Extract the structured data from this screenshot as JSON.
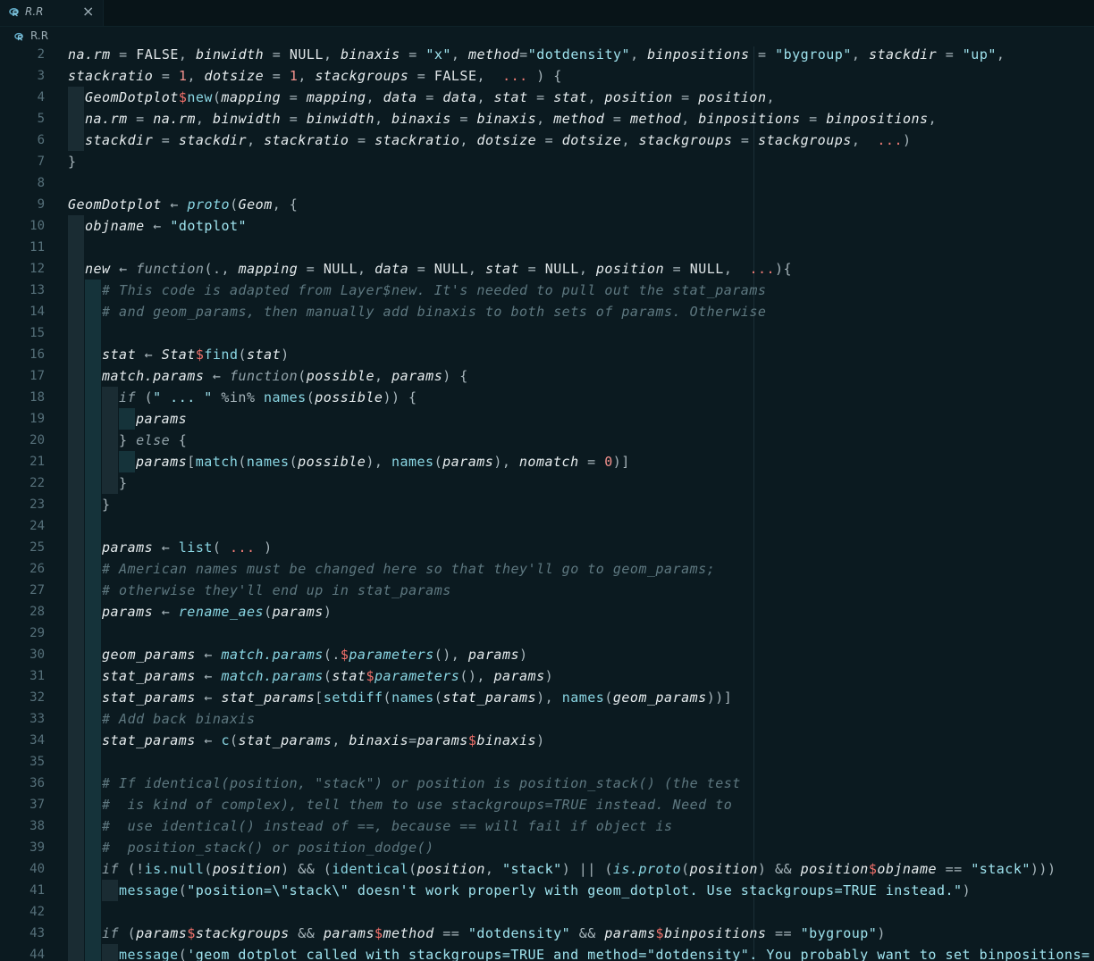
{
  "tab": {
    "label": "R.R",
    "close": "×",
    "icon": "r-file-icon"
  },
  "breadcrumb": {
    "label": "R.R",
    "icon": "r-file-icon"
  },
  "colors": {
    "background": "#0b1a20",
    "string": "#9fe3ee",
    "number": "#f2918d",
    "function": "#8ad6e3",
    "comment": "#5e7880",
    "dollar": "#f2716b"
  },
  "lines": [
    {
      "n": "2",
      "g": 0,
      "t": [
        [
          "arg",
          "na.rm"
        ],
        [
          "op",
          " = "
        ],
        [
          "val",
          "FALSE"
        ],
        [
          "op",
          ", "
        ],
        [
          "arg",
          "binwidth"
        ],
        [
          "op",
          " = "
        ],
        [
          "val",
          "NULL"
        ],
        [
          "op",
          ", "
        ],
        [
          "arg",
          "binaxis"
        ],
        [
          "op",
          " = "
        ],
        [
          "str",
          "\"x\""
        ],
        [
          "op",
          ", "
        ],
        [
          "arg",
          "method"
        ],
        [
          "op",
          "="
        ],
        [
          "str",
          "\"dotdensity\""
        ],
        [
          "op",
          ", "
        ],
        [
          "arg",
          "binpositions"
        ],
        [
          "op",
          " = "
        ],
        [
          "str",
          "\"bygroup\""
        ],
        [
          "op",
          ", "
        ],
        [
          "arg",
          "stackdir"
        ],
        [
          "op",
          " = "
        ],
        [
          "str",
          "\"up\""
        ],
        [
          "op",
          ","
        ]
      ]
    },
    {
      "n": "3",
      "g": 0,
      "t": [
        [
          "arg",
          "stackratio"
        ],
        [
          "op",
          " = "
        ],
        [
          "num",
          "1"
        ],
        [
          "op",
          ", "
        ],
        [
          "arg",
          "dotsize"
        ],
        [
          "op",
          " = "
        ],
        [
          "num",
          "1"
        ],
        [
          "op",
          ", "
        ],
        [
          "arg",
          "stackgroups"
        ],
        [
          "op",
          " = "
        ],
        [
          "val",
          "FALSE"
        ],
        [
          "op",
          ",  "
        ],
        [
          "dots",
          "..."
        ],
        [
          "op",
          " ) {"
        ]
      ]
    },
    {
      "n": "4",
      "g": 1,
      "t": [
        [
          "id",
          "GeomDotplot"
        ],
        [
          "dol",
          "$"
        ],
        [
          "fn",
          "new"
        ],
        [
          "op",
          "("
        ],
        [
          "arg",
          "mapping"
        ],
        [
          "op",
          " = "
        ],
        [
          "id",
          "mapping"
        ],
        [
          "op",
          ", "
        ],
        [
          "arg",
          "data"
        ],
        [
          "op",
          " = "
        ],
        [
          "id",
          "data"
        ],
        [
          "op",
          ", "
        ],
        [
          "arg",
          "stat"
        ],
        [
          "op",
          " = "
        ],
        [
          "id",
          "stat"
        ],
        [
          "op",
          ", "
        ],
        [
          "arg",
          "position"
        ],
        [
          "op",
          " = "
        ],
        [
          "id",
          "position"
        ],
        [
          "op",
          ","
        ]
      ]
    },
    {
      "n": "5",
      "g": 1,
      "t": [
        [
          "arg",
          "na.rm"
        ],
        [
          "op",
          " = "
        ],
        [
          "id",
          "na.rm"
        ],
        [
          "op",
          ", "
        ],
        [
          "arg",
          "binwidth"
        ],
        [
          "op",
          " = "
        ],
        [
          "id",
          "binwidth"
        ],
        [
          "op",
          ", "
        ],
        [
          "arg",
          "binaxis"
        ],
        [
          "op",
          " = "
        ],
        [
          "id",
          "binaxis"
        ],
        [
          "op",
          ", "
        ],
        [
          "arg",
          "method"
        ],
        [
          "op",
          " = "
        ],
        [
          "id",
          "method"
        ],
        [
          "op",
          ", "
        ],
        [
          "arg",
          "binpositions"
        ],
        [
          "op",
          " = "
        ],
        [
          "id",
          "binpositions"
        ],
        [
          "op",
          ","
        ]
      ]
    },
    {
      "n": "6",
      "g": 1,
      "t": [
        [
          "arg",
          "stackdir"
        ],
        [
          "op",
          " = "
        ],
        [
          "id",
          "stackdir"
        ],
        [
          "op",
          ", "
        ],
        [
          "arg",
          "stackratio"
        ],
        [
          "op",
          " = "
        ],
        [
          "id",
          "stackratio"
        ],
        [
          "op",
          ", "
        ],
        [
          "arg",
          "dotsize"
        ],
        [
          "op",
          " = "
        ],
        [
          "id",
          "dotsize"
        ],
        [
          "op",
          ", "
        ],
        [
          "arg",
          "stackgroups"
        ],
        [
          "op",
          " = "
        ],
        [
          "id",
          "stackgroups"
        ],
        [
          "op",
          ",  "
        ],
        [
          "dots",
          "..."
        ],
        [
          "op",
          ")"
        ]
      ]
    },
    {
      "n": "7",
      "g": 0,
      "t": [
        [
          "op",
          "}"
        ]
      ]
    },
    {
      "n": "8",
      "g": 0,
      "t": []
    },
    {
      "n": "9",
      "g": 0,
      "t": [
        [
          "id",
          "GeomDotplot"
        ],
        [
          "op",
          " ← "
        ],
        [
          "fni",
          "proto"
        ],
        [
          "op",
          "("
        ],
        [
          "id",
          "Geom"
        ],
        [
          "op",
          ", {"
        ]
      ]
    },
    {
      "n": "10",
      "g": 1,
      "t": [
        [
          "id",
          "objname"
        ],
        [
          "op",
          " ← "
        ],
        [
          "str",
          "\"dotplot\""
        ]
      ]
    },
    {
      "n": "11",
      "g": 1,
      "t": []
    },
    {
      "n": "12",
      "g": 1,
      "t": [
        [
          "id",
          "new"
        ],
        [
          "op",
          " ← "
        ],
        [
          "kw",
          "function"
        ],
        [
          "op",
          "(., "
        ],
        [
          "arg",
          "mapping"
        ],
        [
          "op",
          " = "
        ],
        [
          "val",
          "NULL"
        ],
        [
          "op",
          ", "
        ],
        [
          "arg",
          "data"
        ],
        [
          "op",
          " = "
        ],
        [
          "val",
          "NULL"
        ],
        [
          "op",
          ", "
        ],
        [
          "arg",
          "stat"
        ],
        [
          "op",
          " = "
        ],
        [
          "val",
          "NULL"
        ],
        [
          "op",
          ", "
        ],
        [
          "arg",
          "position"
        ],
        [
          "op",
          " = "
        ],
        [
          "val",
          "NULL"
        ],
        [
          "op",
          ",  "
        ],
        [
          "dots",
          "..."
        ],
        [
          "op",
          "){"
        ]
      ]
    },
    {
      "n": "13",
      "g": 2,
      "t": [
        [
          "com",
          "# This code is adapted from Layer$new. It's needed to pull out the stat_params"
        ]
      ]
    },
    {
      "n": "14",
      "g": 2,
      "t": [
        [
          "com",
          "# and geom_params, then manually add binaxis to both sets of params. Otherwise"
        ]
      ]
    },
    {
      "n": "15",
      "g": 2,
      "t": []
    },
    {
      "n": "16",
      "g": 2,
      "t": [
        [
          "id",
          "stat"
        ],
        [
          "op",
          " ← "
        ],
        [
          "id",
          "Stat"
        ],
        [
          "dol",
          "$"
        ],
        [
          "fn",
          "find"
        ],
        [
          "op",
          "("
        ],
        [
          "id",
          "stat"
        ],
        [
          "op",
          ")"
        ]
      ]
    },
    {
      "n": "17",
      "g": 2,
      "t": [
        [
          "id",
          "match.params"
        ],
        [
          "op",
          " ← "
        ],
        [
          "kw",
          "function"
        ],
        [
          "op",
          "("
        ],
        [
          "id",
          "possible"
        ],
        [
          "op",
          ", "
        ],
        [
          "id",
          "params"
        ],
        [
          "op",
          ") {"
        ]
      ]
    },
    {
      "n": "18",
      "g": 3,
      "t": [
        [
          "kw",
          "if"
        ],
        [
          "op",
          " ("
        ],
        [
          "str",
          "\" ... \""
        ],
        [
          "op",
          " %in% "
        ],
        [
          "fn",
          "names"
        ],
        [
          "op",
          "("
        ],
        [
          "id",
          "possible"
        ],
        [
          "op",
          ")) {"
        ]
      ]
    },
    {
      "n": "19",
      "g": 4,
      "t": [
        [
          "id",
          "params"
        ]
      ]
    },
    {
      "n": "20",
      "g": 3,
      "t": [
        [
          "op",
          "} "
        ],
        [
          "kw",
          "else"
        ],
        [
          "op",
          " {"
        ]
      ]
    },
    {
      "n": "21",
      "g": 4,
      "t": [
        [
          "id",
          "params"
        ],
        [
          "op",
          "["
        ],
        [
          "fn",
          "match"
        ],
        [
          "op",
          "("
        ],
        [
          "fn",
          "names"
        ],
        [
          "op",
          "("
        ],
        [
          "id",
          "possible"
        ],
        [
          "op",
          "), "
        ],
        [
          "fn",
          "names"
        ],
        [
          "op",
          "("
        ],
        [
          "id",
          "params"
        ],
        [
          "op",
          "), "
        ],
        [
          "arg",
          "nomatch"
        ],
        [
          "op",
          " = "
        ],
        [
          "num",
          "0"
        ],
        [
          "op",
          ")]"
        ]
      ]
    },
    {
      "n": "22",
      "g": 3,
      "t": [
        [
          "op",
          "}"
        ]
      ]
    },
    {
      "n": "23",
      "g": 2,
      "t": [
        [
          "op",
          "}"
        ]
      ]
    },
    {
      "n": "24",
      "g": 2,
      "t": []
    },
    {
      "n": "25",
      "g": 2,
      "t": [
        [
          "id",
          "params"
        ],
        [
          "op",
          " ← "
        ],
        [
          "fn",
          "list"
        ],
        [
          "op",
          "( "
        ],
        [
          "dots",
          "..."
        ],
        [
          "op",
          " )"
        ]
      ]
    },
    {
      "n": "26",
      "g": 2,
      "t": [
        [
          "com",
          "# American names must be changed here so that they'll go to geom_params;"
        ]
      ]
    },
    {
      "n": "27",
      "g": 2,
      "t": [
        [
          "com",
          "# otherwise they'll end up in stat_params"
        ]
      ]
    },
    {
      "n": "28",
      "g": 2,
      "t": [
        [
          "id",
          "params"
        ],
        [
          "op",
          " ← "
        ],
        [
          "fni",
          "rename_aes"
        ],
        [
          "op",
          "("
        ],
        [
          "id",
          "params"
        ],
        [
          "op",
          ")"
        ]
      ]
    },
    {
      "n": "29",
      "g": 2,
      "t": []
    },
    {
      "n": "30",
      "g": 2,
      "t": [
        [
          "id",
          "geom_params"
        ],
        [
          "op",
          " ← "
        ],
        [
          "fni",
          "match.params"
        ],
        [
          "op",
          "(."
        ],
        [
          "dol",
          "$"
        ],
        [
          "fni",
          "parameters"
        ],
        [
          "op",
          "(), "
        ],
        [
          "id",
          "params"
        ],
        [
          "op",
          ")"
        ]
      ]
    },
    {
      "n": "31",
      "g": 2,
      "t": [
        [
          "id",
          "stat_params"
        ],
        [
          "op",
          " ← "
        ],
        [
          "fni",
          "match.params"
        ],
        [
          "op",
          "("
        ],
        [
          "id",
          "stat"
        ],
        [
          "dol",
          "$"
        ],
        [
          "fni",
          "parameters"
        ],
        [
          "op",
          "(), "
        ],
        [
          "id",
          "params"
        ],
        [
          "op",
          ")"
        ]
      ]
    },
    {
      "n": "32",
      "g": 2,
      "t": [
        [
          "id",
          "stat_params"
        ],
        [
          "op",
          " ← "
        ],
        [
          "id",
          "stat_params"
        ],
        [
          "op",
          "["
        ],
        [
          "fn",
          "setdiff"
        ],
        [
          "op",
          "("
        ],
        [
          "fn",
          "names"
        ],
        [
          "op",
          "("
        ],
        [
          "id",
          "stat_params"
        ],
        [
          "op",
          "), "
        ],
        [
          "fn",
          "names"
        ],
        [
          "op",
          "("
        ],
        [
          "id",
          "geom_params"
        ],
        [
          "op",
          "))]"
        ]
      ]
    },
    {
      "n": "33",
      "g": 2,
      "t": [
        [
          "com",
          "# Add back binaxis"
        ]
      ]
    },
    {
      "n": "34",
      "g": 2,
      "t": [
        [
          "id",
          "stat_params"
        ],
        [
          "op",
          " ← "
        ],
        [
          "fn",
          "c"
        ],
        [
          "op",
          "("
        ],
        [
          "id",
          "stat_params"
        ],
        [
          "op",
          ", "
        ],
        [
          "ital",
          "binaxis"
        ],
        [
          "op",
          "="
        ],
        [
          "id",
          "params"
        ],
        [
          "dol",
          "$"
        ],
        [
          "id",
          "binaxis"
        ],
        [
          "op",
          ")"
        ]
      ]
    },
    {
      "n": "35",
      "g": 2,
      "t": []
    },
    {
      "n": "36",
      "g": 2,
      "t": [
        [
          "com",
          "# If identical(position, \"stack\") or position is position_stack() (the test"
        ]
      ]
    },
    {
      "n": "37",
      "g": 2,
      "t": [
        [
          "com",
          "#  is kind of complex), tell them to use stackgroups=TRUE instead. Need to"
        ]
      ]
    },
    {
      "n": "38",
      "g": 2,
      "t": [
        [
          "com",
          "#  use identical() instead of ==, because == will fail if object is"
        ]
      ]
    },
    {
      "n": "39",
      "g": 2,
      "t": [
        [
          "com",
          "#  position_stack() or position_dodge()"
        ]
      ]
    },
    {
      "n": "40",
      "g": 2,
      "t": [
        [
          "kw",
          "if"
        ],
        [
          "op",
          " (!"
        ],
        [
          "fn",
          "is.null"
        ],
        [
          "op",
          "("
        ],
        [
          "id",
          "position"
        ],
        [
          "op",
          ") && ("
        ],
        [
          "fn",
          "identical"
        ],
        [
          "op",
          "("
        ],
        [
          "id",
          "position"
        ],
        [
          "op",
          ", "
        ],
        [
          "str",
          "\"stack\""
        ],
        [
          "op",
          ") || ("
        ],
        [
          "fni",
          "is.proto"
        ],
        [
          "op",
          "("
        ],
        [
          "id",
          "position"
        ],
        [
          "op",
          ") && "
        ],
        [
          "id",
          "position"
        ],
        [
          "dol",
          "$"
        ],
        [
          "id",
          "objname"
        ],
        [
          "op",
          " == "
        ],
        [
          "str",
          "\"stack\""
        ],
        [
          "op",
          ")))"
        ]
      ]
    },
    {
      "n": "41",
      "g": 3,
      "t": [
        [
          "fn",
          "message"
        ],
        [
          "op",
          "("
        ],
        [
          "str",
          "\"position=\\\"stack\\\" doesn't work properly with geom_dotplot. Use stackgroups=TRUE instead.\""
        ],
        [
          "op",
          ")"
        ]
      ]
    },
    {
      "n": "42",
      "g": 2,
      "t": []
    },
    {
      "n": "43",
      "g": 2,
      "t": [
        [
          "kw",
          "if"
        ],
        [
          "op",
          " ("
        ],
        [
          "id",
          "params"
        ],
        [
          "dol",
          "$"
        ],
        [
          "id",
          "stackgroups"
        ],
        [
          "op",
          " && "
        ],
        [
          "id",
          "params"
        ],
        [
          "dol",
          "$"
        ],
        [
          "id",
          "method"
        ],
        [
          "op",
          " == "
        ],
        [
          "str",
          "\"dotdensity\""
        ],
        [
          "op",
          " && "
        ],
        [
          "id",
          "params"
        ],
        [
          "dol",
          "$"
        ],
        [
          "id",
          "binpositions"
        ],
        [
          "op",
          " == "
        ],
        [
          "str",
          "\"bygroup\""
        ],
        [
          "op",
          ")"
        ]
      ]
    },
    {
      "n": "44",
      "g": 3,
      "t": [
        [
          "fn",
          "message"
        ],
        [
          "op",
          "("
        ],
        [
          "str",
          "'geom_dotplot called with stackgroups=TRUE and method=\"dotdensity\". You probably want to set binpositions="
        ]
      ]
    }
  ]
}
